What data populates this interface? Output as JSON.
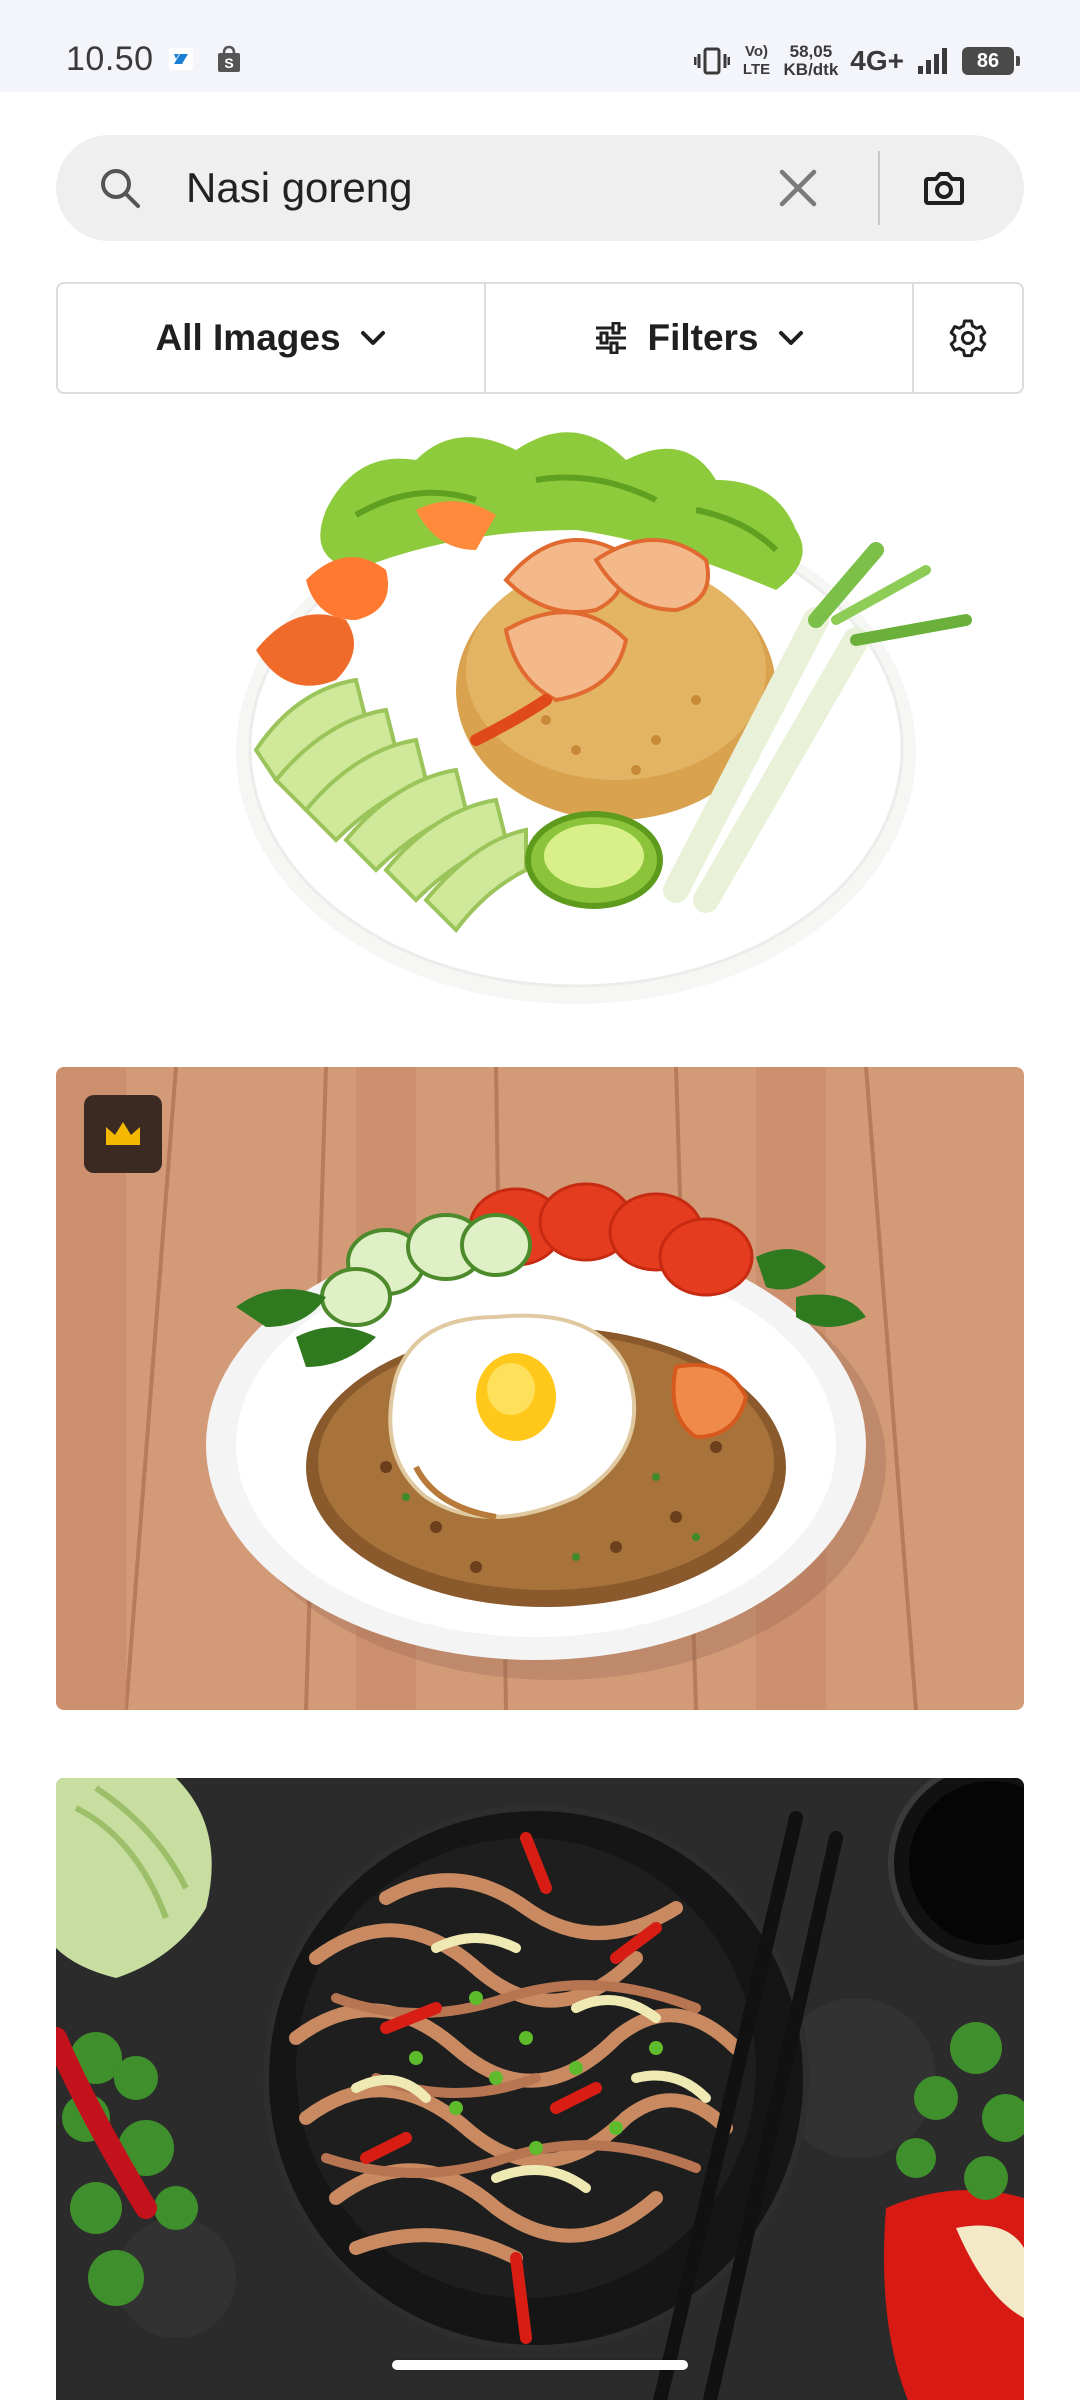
{
  "status_bar": {
    "time": "10.50",
    "app_icons": [
      "browser-app-icon",
      "shopping-bag-icon"
    ],
    "volte": "Vo) LTE",
    "speed_value": "58,05",
    "speed_unit": "KB/dtk",
    "network": "4G+",
    "battery": "86"
  },
  "search": {
    "query": "Nasi goreng",
    "icons": [
      "search-icon",
      "clear-icon",
      "camera-icon"
    ]
  },
  "filters": {
    "all_images_label": "All Images",
    "filters_label": "Filters",
    "icons": [
      "chevron-down-icon",
      "sliders-icon",
      "gear-icon"
    ]
  },
  "results": [
    {
      "description_icon": "food-photo",
      "premium": false
    },
    {
      "description_icon": "food-photo",
      "premium": true,
      "badge_icon": "crown-icon"
    },
    {
      "description_icon": "food-photo",
      "premium": false
    }
  ],
  "colors": {
    "status_bg": "#f4f5fa",
    "search_bg": "#efefef",
    "border": "#dcdcdc",
    "crown": "#f5b800",
    "badge_bg": "#3a2a22"
  }
}
